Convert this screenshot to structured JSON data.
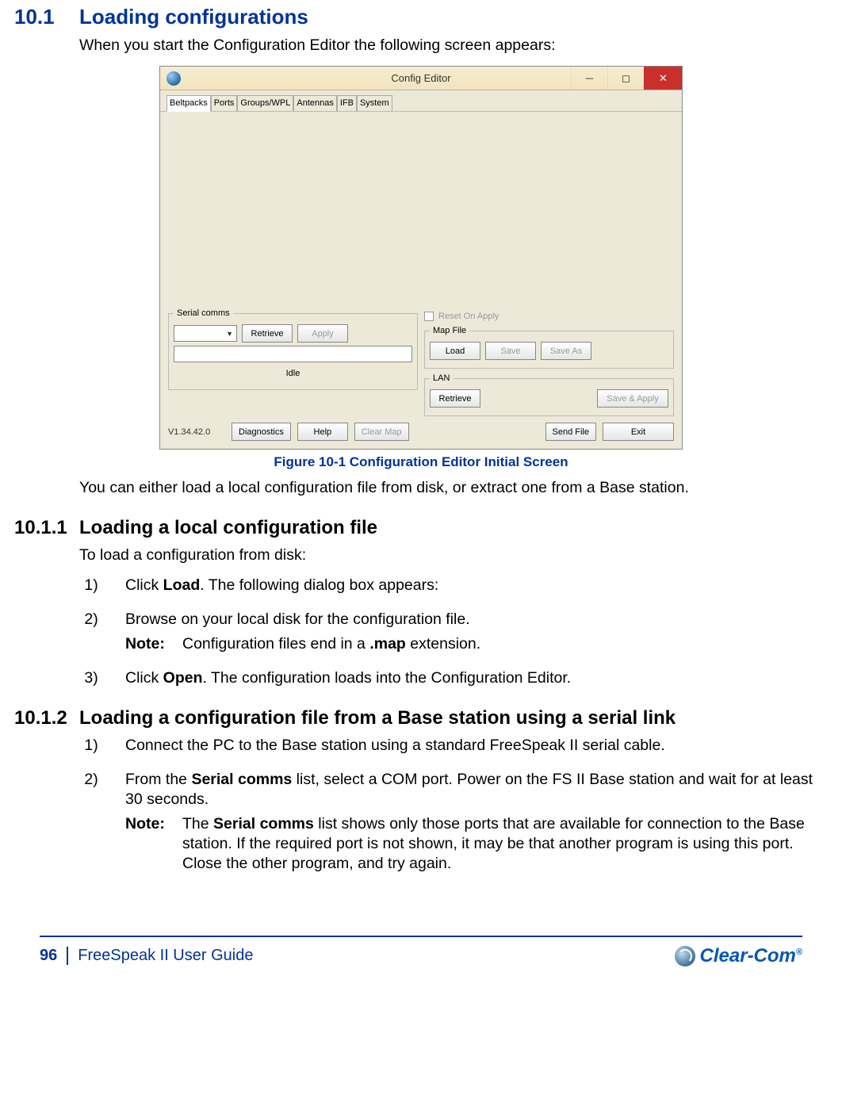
{
  "section": {
    "number": "10.1",
    "title": "Loading configurations",
    "intro": "When you start the Configuration Editor the following screen appears:"
  },
  "figure": {
    "caption": "Figure 10-1 Configuration Editor Initial Screen",
    "after_text": "You can either load a local configuration file from disk, or extract one from a Base station."
  },
  "config_editor": {
    "title": "Config Editor",
    "tabs": [
      "Beltpacks",
      "Ports",
      "Groups/WPL",
      "Antennas",
      "IFB",
      "System"
    ],
    "serial_comms_legend": "Serial comms",
    "btn_retrieve": "Retrieve",
    "btn_apply": "Apply",
    "reset_on_apply": "Reset On Apply",
    "idle": "Idle",
    "map_file_legend": "Map File",
    "btn_load": "Load",
    "btn_save": "Save",
    "btn_saveas": "Save As",
    "lan_legend": "LAN",
    "btn_lan_retrieve": "Retrieve",
    "btn_save_apply": "Save & Apply",
    "version": "V1.34.42.0",
    "btn_diagnostics": "Diagnostics",
    "btn_help": "Help",
    "btn_clearmap": "Clear Map",
    "btn_sendfile": "Send File",
    "btn_exit": "Exit"
  },
  "sub1": {
    "number": "10.1.1",
    "title": "Loading a local configuration file",
    "intro": "To load a configuration from disk:",
    "steps": {
      "s1_pre": "Click ",
      "s1_bold": "Load",
      "s1_post": ". The following dialog box appears:",
      "s2": "Browse on your local disk for the configuration file.",
      "s2_note_label": "Note:",
      "s2_note_pre": "Configuration files end in a ",
      "s2_note_bold": ".map",
      "s2_note_post": " extension.",
      "s3_pre": "Click ",
      "s3_bold": "Open",
      "s3_post": ". The configuration loads into the Configuration Editor."
    }
  },
  "sub2": {
    "number": "10.1.2",
    "title": "Loading a configuration file from a Base station using a serial link",
    "steps": {
      "s1": "Connect the PC to the Base station using a standard FreeSpeak II serial cable.",
      "s2_pre": "From the ",
      "s2_bold": "Serial comms",
      "s2_post": " list, select a COM port. Power on the FS II Base station and wait for at least 30 seconds.",
      "s2_note_label": "Note:",
      "s2_note_pre": "The ",
      "s2_note_bold": "Serial comms",
      "s2_note_post": " list shows only those ports that are available for connection to the Base station. If the required port is not shown, it may be that another program is using this port. Close the other program, and try again."
    }
  },
  "footer": {
    "page": "96",
    "guide": "FreeSpeak II User Guide",
    "brand": "Clear-Com"
  }
}
